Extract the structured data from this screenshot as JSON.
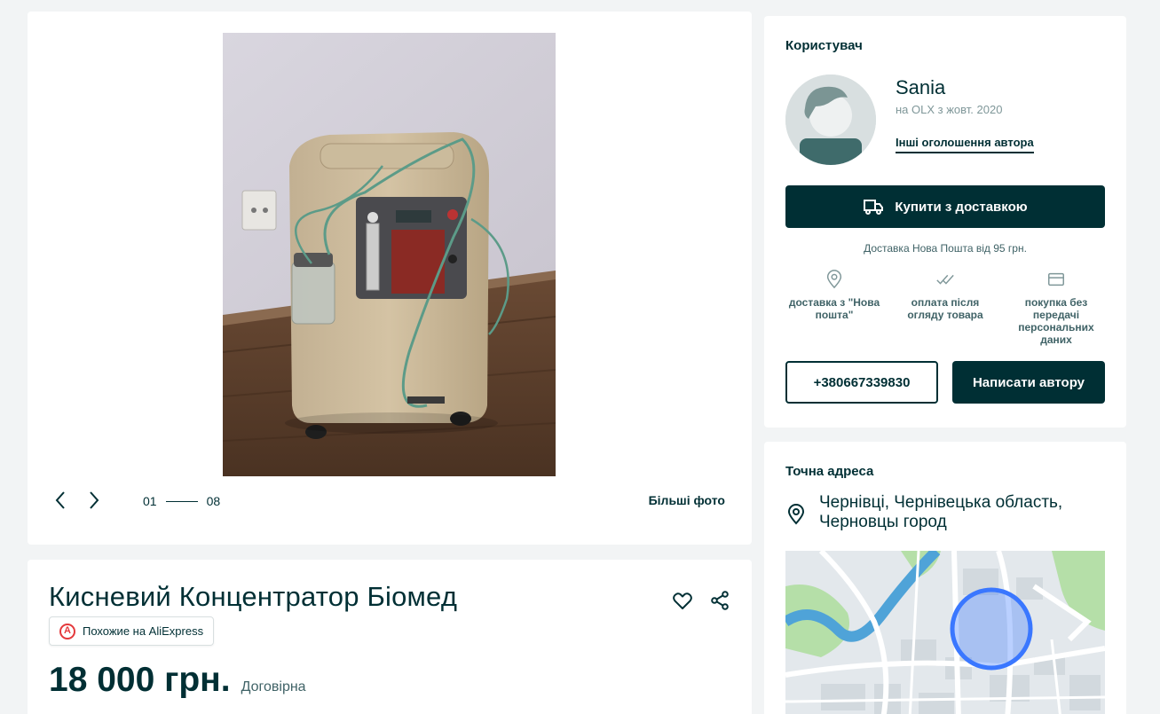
{
  "gallery": {
    "current": "01",
    "total": "08",
    "more_photo_label": "Більші фото"
  },
  "listing": {
    "title": "Кисневий Концентратор Біомед",
    "ali_badge": "Похожие на AliExpress",
    "price": "18 000 грн.",
    "negotiable": "Договірна"
  },
  "user": {
    "section_title": "Користувач",
    "name": "Sania",
    "since": "на OLX з жовт. 2020",
    "other_ads": "Інші оголошення автора",
    "buy_label": "Купити з доставкою",
    "delivery_note": "Доставка Нова Пошта від 95 грн.",
    "features": [
      {
        "icon": "location-pin-icon",
        "label": "доставка з \"Нова пошта\""
      },
      {
        "icon": "double-check-icon",
        "label": "оплата після огляду товара"
      },
      {
        "icon": "credit-card-icon",
        "label": "покупка без передачі персональних даних"
      }
    ],
    "phone": "+380667339830",
    "message_label": "Написати автору"
  },
  "address": {
    "section_title": "Точна адреса",
    "text": "Чернівці, Чернівецька область, Черновцы город"
  },
  "colors": {
    "primary": "#002f34",
    "background": "#f2f4f5",
    "map_circle": "#3a77ff",
    "aliexpress": "#e4393c"
  }
}
